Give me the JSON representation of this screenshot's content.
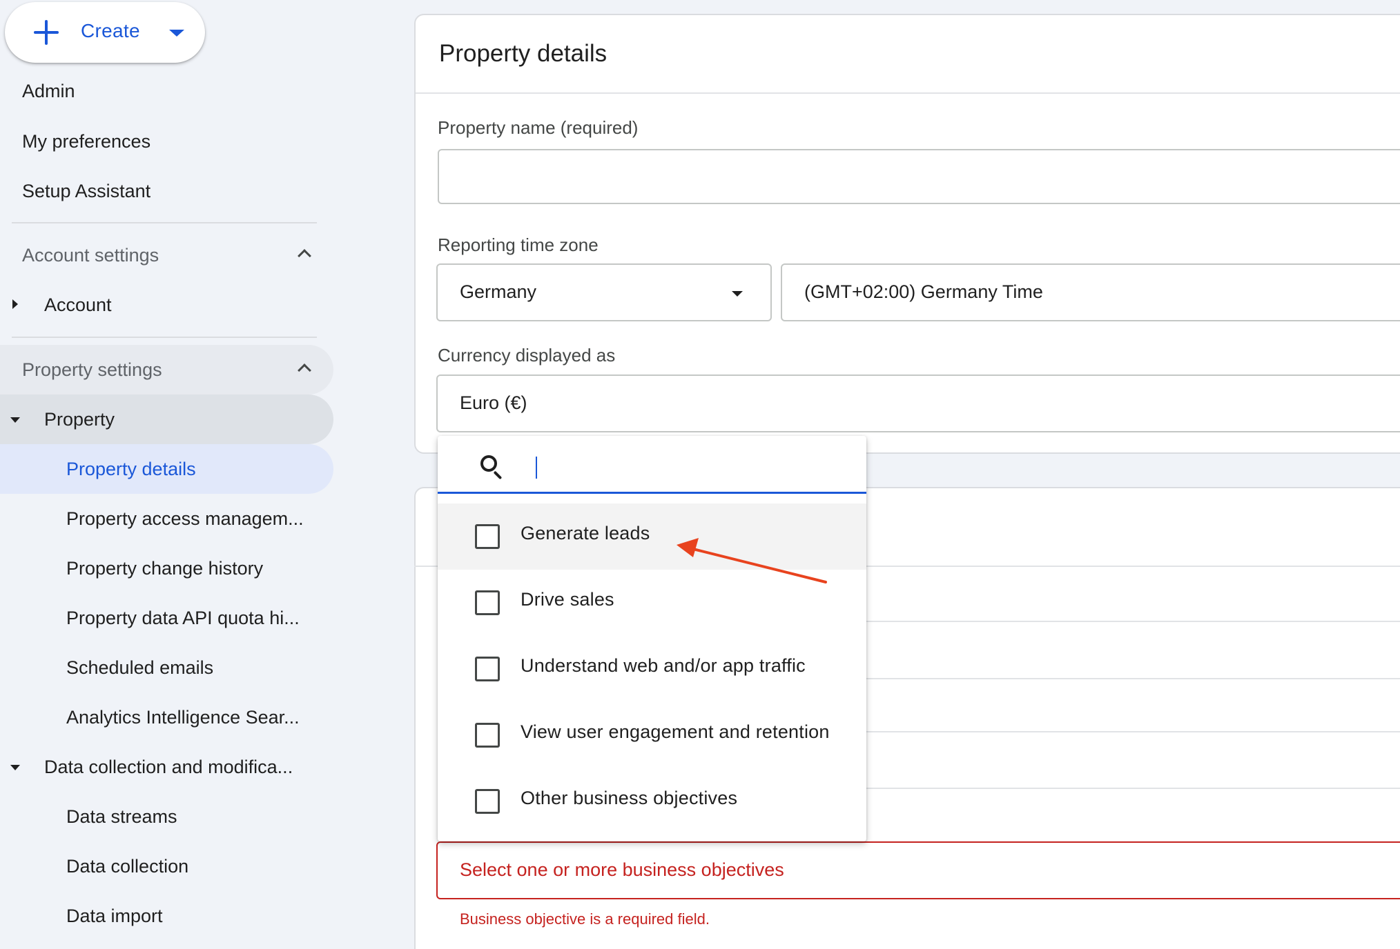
{
  "sidebar": {
    "create_label": "Create",
    "items": {
      "admin": "Admin",
      "preferences": "My preferences",
      "setup": "Setup Assistant"
    },
    "account_section": "Account settings",
    "account_item": "Account",
    "property_section": "Property settings",
    "property_item": "Property",
    "property_children": [
      "Property details",
      "Property access managem...",
      "Property change history",
      "Property data API quota hi...",
      "Scheduled emails",
      "Analytics Intelligence Sear..."
    ],
    "data_collection_item": "Data collection and modifica...",
    "data_children": [
      "Data streams",
      "Data collection",
      "Data import"
    ]
  },
  "main": {
    "title": "Property details",
    "property_name_label": "Property name (required)",
    "property_name_value": "",
    "timezone_label": "Reporting time zone",
    "timezone_country": "Germany",
    "timezone_value": "(GMT+02:00) Germany Time",
    "currency_label": "Currency displayed as",
    "currency_value": "Euro (€)",
    "objectives_placeholder": "Select one or more business objectives",
    "objectives_error": "Business objective is a required field."
  },
  "dropdown": {
    "search_value": "",
    "options": [
      "Generate leads",
      "Drive sales",
      "Understand web and/or app traffic",
      "View user engagement and retention",
      "Other business objectives"
    ]
  },
  "colors": {
    "accent": "#1a57d8",
    "error": "#c5221f",
    "annotation_arrow": "#e8431e",
    "active_nav_bg": "#e1e8fa"
  }
}
